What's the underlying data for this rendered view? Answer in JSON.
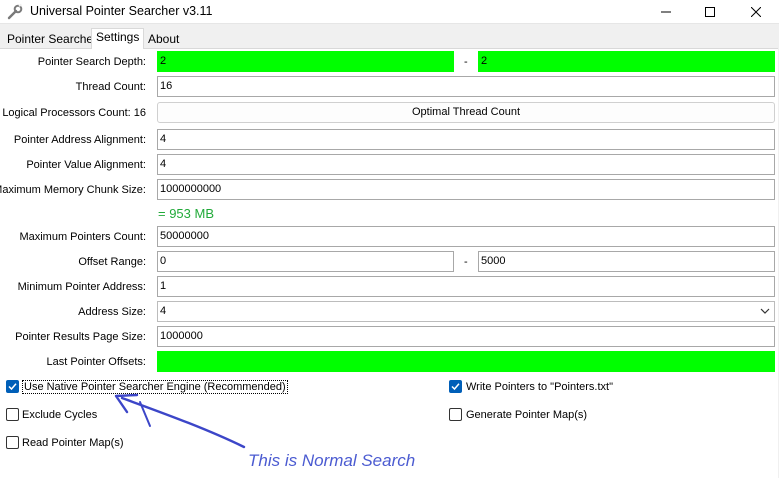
{
  "window": {
    "title": "Universal Pointer Searcher v3.11",
    "icon": "wrench-icon",
    "controls": [
      "minimize-icon",
      "maximize-icon",
      "close-icon"
    ]
  },
  "tabs": [
    {
      "label": "Pointer Searcher",
      "active": false
    },
    {
      "label": "Settings",
      "active": true
    },
    {
      "label": "About",
      "active": false
    }
  ],
  "settings": {
    "search_depth": {
      "label": "Pointer Search Depth:",
      "from": "2",
      "separator": "-",
      "to": "2"
    },
    "thread_count": {
      "label": "Thread Count:",
      "value": "16"
    },
    "logical_processors": {
      "label": "Logical Processors Count: 16",
      "button": "Optimal Thread Count"
    },
    "address_alignment": {
      "label": "Pointer Address Alignment:",
      "value": "4"
    },
    "value_alignment": {
      "label": "Pointer Value Alignment:",
      "value": "4"
    },
    "chunk_size": {
      "label": "Maximum Memory Chunk Size:",
      "value": "1000000000",
      "converted": "= 953 MB"
    },
    "max_pointers": {
      "label": "Maximum Pointers Count:",
      "value": "50000000"
    },
    "offset_range": {
      "label": "Offset Range:",
      "from": "0",
      "separator": "-",
      "to": "5000"
    },
    "min_pointer_address": {
      "label": "Minimum Pointer Address:",
      "value": "1"
    },
    "address_size": {
      "label": "Address Size:",
      "value": "4"
    },
    "results_page_size": {
      "label": "Pointer Results Page Size:",
      "value": "1000000"
    },
    "last_offsets": {
      "label": "Last Pointer Offsets:",
      "value": ""
    }
  },
  "options": {
    "native_engine": {
      "label": "Use Native Pointer Searcher Engine (Recommended)",
      "checked": true
    },
    "write_pointers": {
      "label": "Write Pointers to \"Pointers.txt\"",
      "checked": true
    },
    "exclude_cycles": {
      "label": "Exclude Cycles",
      "checked": false
    },
    "generate_maps": {
      "label": "Generate Pointer Map(s)",
      "checked": false
    },
    "read_maps": {
      "label": "Read Pointer Map(s)",
      "checked": false
    }
  },
  "annotation": {
    "text": "This is Normal Search"
  },
  "colors": {
    "highlight_green": "#00ff00",
    "mb_text": "#22aa3a",
    "annotation": "#4b5bd1",
    "checkbox_accent": "#005fb8"
  }
}
